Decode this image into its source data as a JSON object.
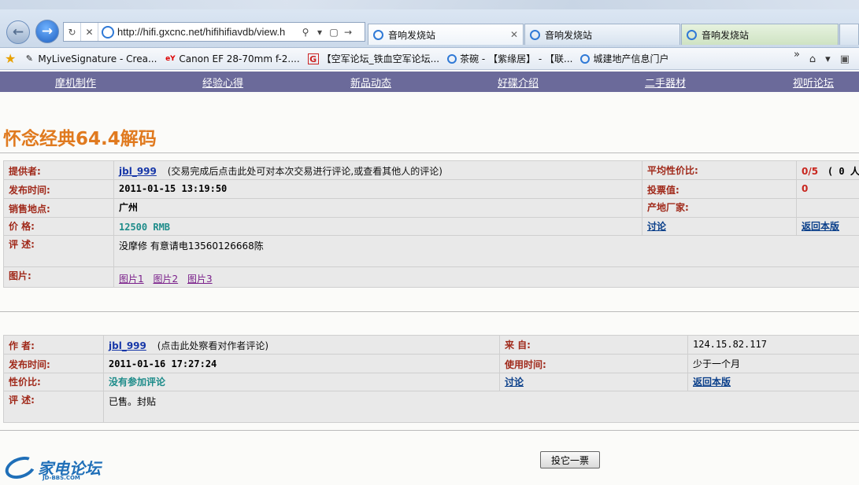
{
  "browser": {
    "url": "http://hifi.gxcnc.net/hifihifiavdb/view.h",
    "tabs": [
      {
        "label": "音响发烧站",
        "active": true
      },
      {
        "label": "音响发烧站",
        "active": false
      },
      {
        "label": "音响发烧站",
        "active": false
      }
    ],
    "favorites": [
      {
        "label": "MyLiveSignature - Crea..."
      },
      {
        "label": "Canon EF 28-70mm f-2...."
      },
      {
        "label": "【空军论坛_铁血空军论坛..."
      },
      {
        "label": "茶碗 - 【紫缘居】 - 【联..."
      },
      {
        "label": "城建地产信息门户"
      }
    ],
    "more": "»"
  },
  "site_nav": [
    "摩机制作",
    "经验心得",
    "新品动态",
    "好碟介绍",
    "二手器材",
    "视听论坛"
  ],
  "title": "怀念经典64.4解码",
  "listing": {
    "provider_label": "提供者:",
    "provider": "jbl_999",
    "provider_note": "(交易完成后点击此处可对本次交易进行评论,或查看其他人的评论)",
    "avg_label": "平均性价比:",
    "avg_value": "0/5",
    "avg_extra": "( 0 人",
    "date_label": "发布时间:",
    "date": "2011-01-15 13:19:50",
    "votes_label": "投票值:",
    "votes": "0",
    "location_label": "销售地点:",
    "location": "广州",
    "maker_label": "产地厂家:",
    "maker": "",
    "price_label": "价  格:",
    "price": "12500 RMB",
    "discuss": "讨论",
    "back": "返回本版",
    "desc_label": "评  述:",
    "desc": "没摩修 有意请电13560126668陈",
    "pics_label": "图片:",
    "pics": [
      "图片1",
      "图片2",
      "图片3"
    ]
  },
  "comment": {
    "author_label": "作  者:",
    "author": "jbl_999",
    "author_note": "(点击此处察看对作者评论)",
    "from_label": "来  自:",
    "from": "124.15.82.117",
    "date_label": "发布时间:",
    "date": "2011-01-16 17:27:24",
    "usage_label": "使用时间:",
    "usage": "少于一个月",
    "ratio_label": "性价比:",
    "ratio": "没有参加评论",
    "discuss": "讨论",
    "back": "返回本版",
    "desc_label": "评  述:",
    "desc": "已售。封贴"
  },
  "vote_button": "投它一票",
  "logo": {
    "text": "家电论坛",
    "sub": "JD-BBS.COM"
  }
}
